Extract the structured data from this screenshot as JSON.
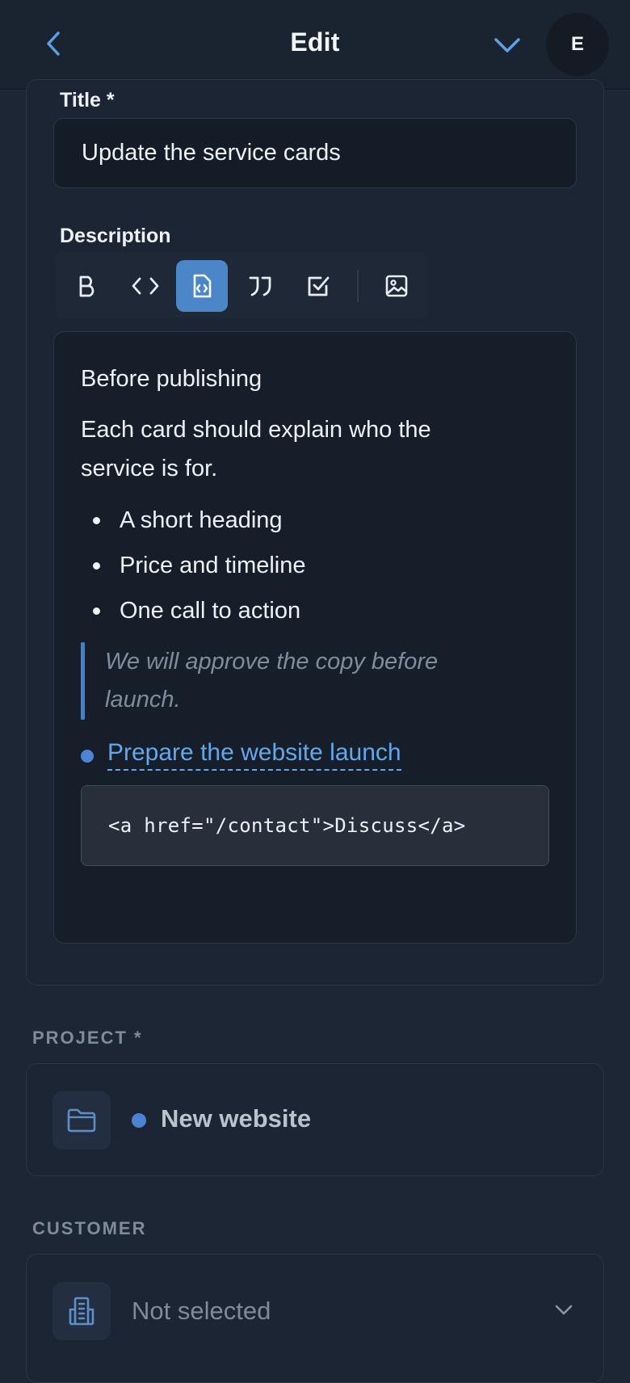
{
  "header": {
    "title": "Edit",
    "avatar_initial": "E",
    "back_icon": "chevron-left-icon",
    "collapse_icon": "chevron-down-icon"
  },
  "form": {
    "title_label": "Title *",
    "title_value": "Update the service cards",
    "description_label": "Description"
  },
  "toolbar": {
    "buttons": [
      {
        "name": "bold",
        "icon": "bold-icon",
        "label": "B"
      },
      {
        "name": "inline-code",
        "icon": "code-icon"
      },
      {
        "name": "code-block",
        "icon": "code-file-icon",
        "active": true
      },
      {
        "name": "quote",
        "icon": "quote-icon"
      },
      {
        "name": "task",
        "icon": "checkbox-icon"
      },
      {
        "name": "image",
        "icon": "image-icon"
      }
    ]
  },
  "editor": {
    "heading": "Before publishing",
    "paragraph_line1": "Each card should explain who the",
    "paragraph_line2": "service is for.",
    "bullets": [
      "A short heading",
      "Price and timeline",
      "One call to action"
    ],
    "quote_line1": "We will approve the copy before",
    "quote_line2": "launch.",
    "task_link": "Prepare the website launch",
    "code": "<a href=\"/contact\">Discuss</a>"
  },
  "project": {
    "section_label": "PROJECT *",
    "value": "New website",
    "icon": "folder-icon",
    "dot_color": "#4a82d4"
  },
  "customer": {
    "section_label": "CUSTOMER",
    "value": "Not selected",
    "icon": "building-icon"
  },
  "colors": {
    "accent": "#4a86c8",
    "link": "#63a7ec",
    "background": "#1c2635"
  }
}
